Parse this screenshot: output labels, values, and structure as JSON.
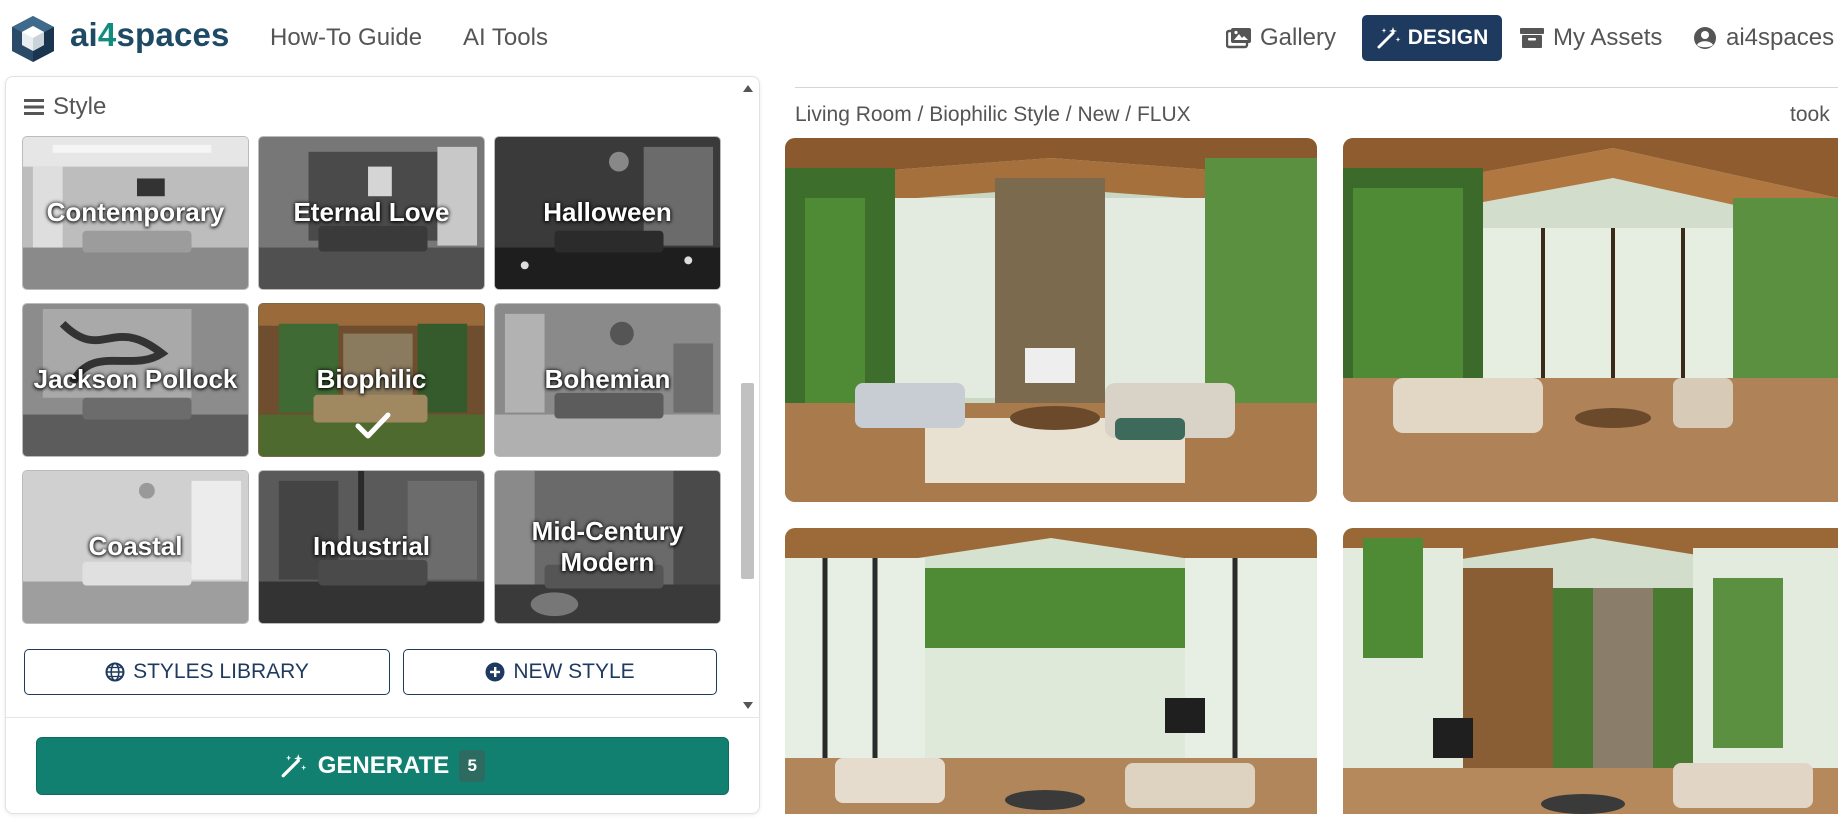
{
  "brand": {
    "name_a": "ai",
    "name_b": "4",
    "name_c": "spaces"
  },
  "nav": {
    "guide": "How-To Guide",
    "tools": "AI Tools"
  },
  "header_actions": {
    "gallery": "Gallery",
    "design": "DESIGN",
    "assets": "My Assets",
    "account": "ai4spaces"
  },
  "panel": {
    "title": "Style",
    "styles": [
      {
        "label": "Contemporary",
        "selected": false
      },
      {
        "label": "Eternal Love",
        "selected": false
      },
      {
        "label": "Halloween",
        "selected": false
      },
      {
        "label": "Jackson Pollock",
        "selected": false
      },
      {
        "label": "Biophilic",
        "selected": true
      },
      {
        "label": "Bohemian",
        "selected": false
      },
      {
        "label": "Coastal",
        "selected": false
      },
      {
        "label": "Industrial",
        "selected": false
      },
      {
        "label": "Mid-Century Modern",
        "selected": false
      }
    ],
    "library_button": "STYLES LIBRARY",
    "new_style_button": "NEW STYLE",
    "generate_button": "GENERATE",
    "generate_count": "5"
  },
  "content": {
    "breadcrumb": "Living Room / Biophilic Style / New / FLUX",
    "meta_right": "took"
  },
  "colors": {
    "primary": "#1f3a5f",
    "accent": "#128071",
    "brand_teal": "#128c7e"
  }
}
